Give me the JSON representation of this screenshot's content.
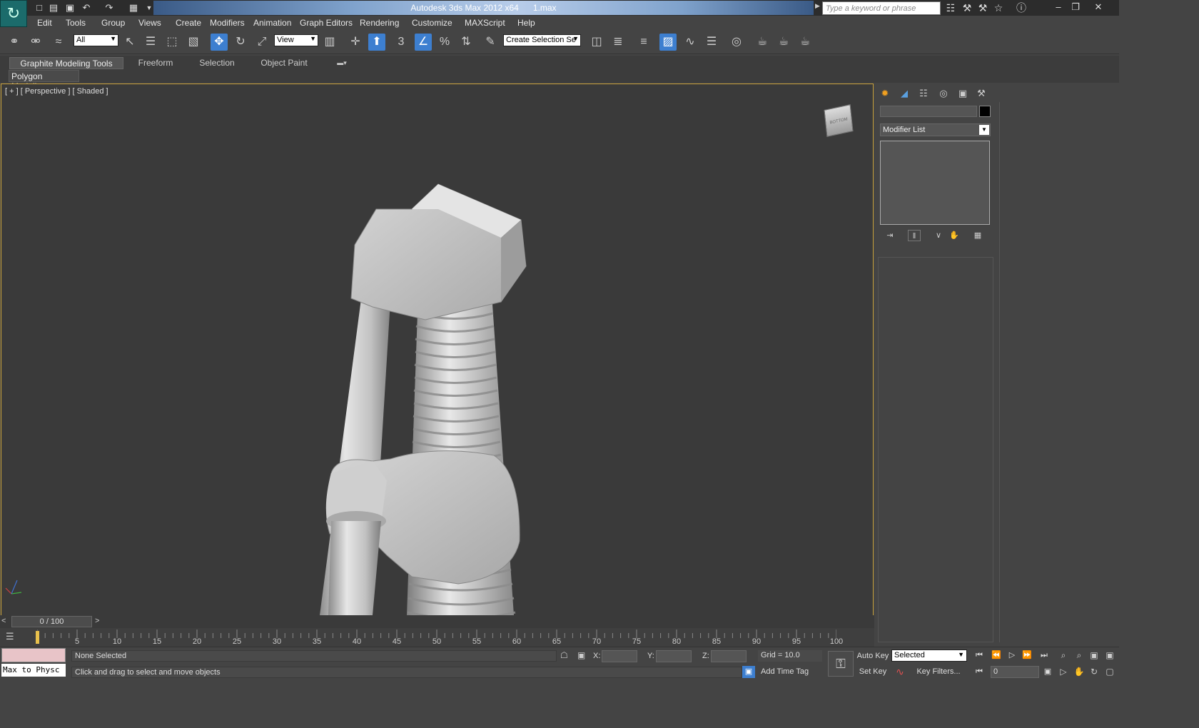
{
  "title": {
    "app": "Autodesk 3ds Max  2012 x64",
    "file": "1.max",
    "search_placeholder": "Type a keyword or phrase"
  },
  "menu": [
    "Edit",
    "Tools",
    "Group",
    "Views",
    "Create",
    "Modifiers",
    "Animation",
    "Graph Editors",
    "Rendering",
    "Customize",
    "MAXScript",
    "Help"
  ],
  "toolbar": {
    "selection_filter": "All",
    "ref_coord": "View",
    "named_selection": "Create Selection Se",
    "snap_label": "3"
  },
  "ribbon": {
    "tabs": [
      "Graphite Modeling Tools",
      "Freeform",
      "Selection",
      "Object Paint"
    ],
    "active_tab": "Graphite Modeling Tools",
    "sub_button": "Polygon Modeling"
  },
  "viewport": {
    "label": "[ + ] [ Perspective ] [ Shaded ]",
    "viewcube_label": "BOTTOM"
  },
  "command_panel": {
    "modifier_list": "Modifier List"
  },
  "timeline": {
    "position": "0 / 100",
    "ticks": [
      "5",
      "10",
      "15",
      "20",
      "25",
      "30",
      "35",
      "40",
      "45",
      "50",
      "55",
      "60",
      "65",
      "70",
      "75",
      "80",
      "85",
      "90",
      "95",
      "100"
    ],
    "current_frame": "0"
  },
  "status": {
    "maxscript": "Max to Physc",
    "selection": "None Selected",
    "prompt": "Click and drag to select and move objects",
    "x_label": "X:",
    "y_label": "Y:",
    "z_label": "Z:",
    "grid": "Grid = 10.0",
    "add_time_tag": "Add Time Tag",
    "auto_key": "Auto Key",
    "set_key": "Set Key",
    "key_mode": "Selected",
    "key_filters": "Key Filters..."
  },
  "colors": {
    "accent": "#3d7fd0",
    "viewport_border": "#c9a13b",
    "viewport_bg": "#3a3a3a",
    "object": "#d8d8d8"
  }
}
